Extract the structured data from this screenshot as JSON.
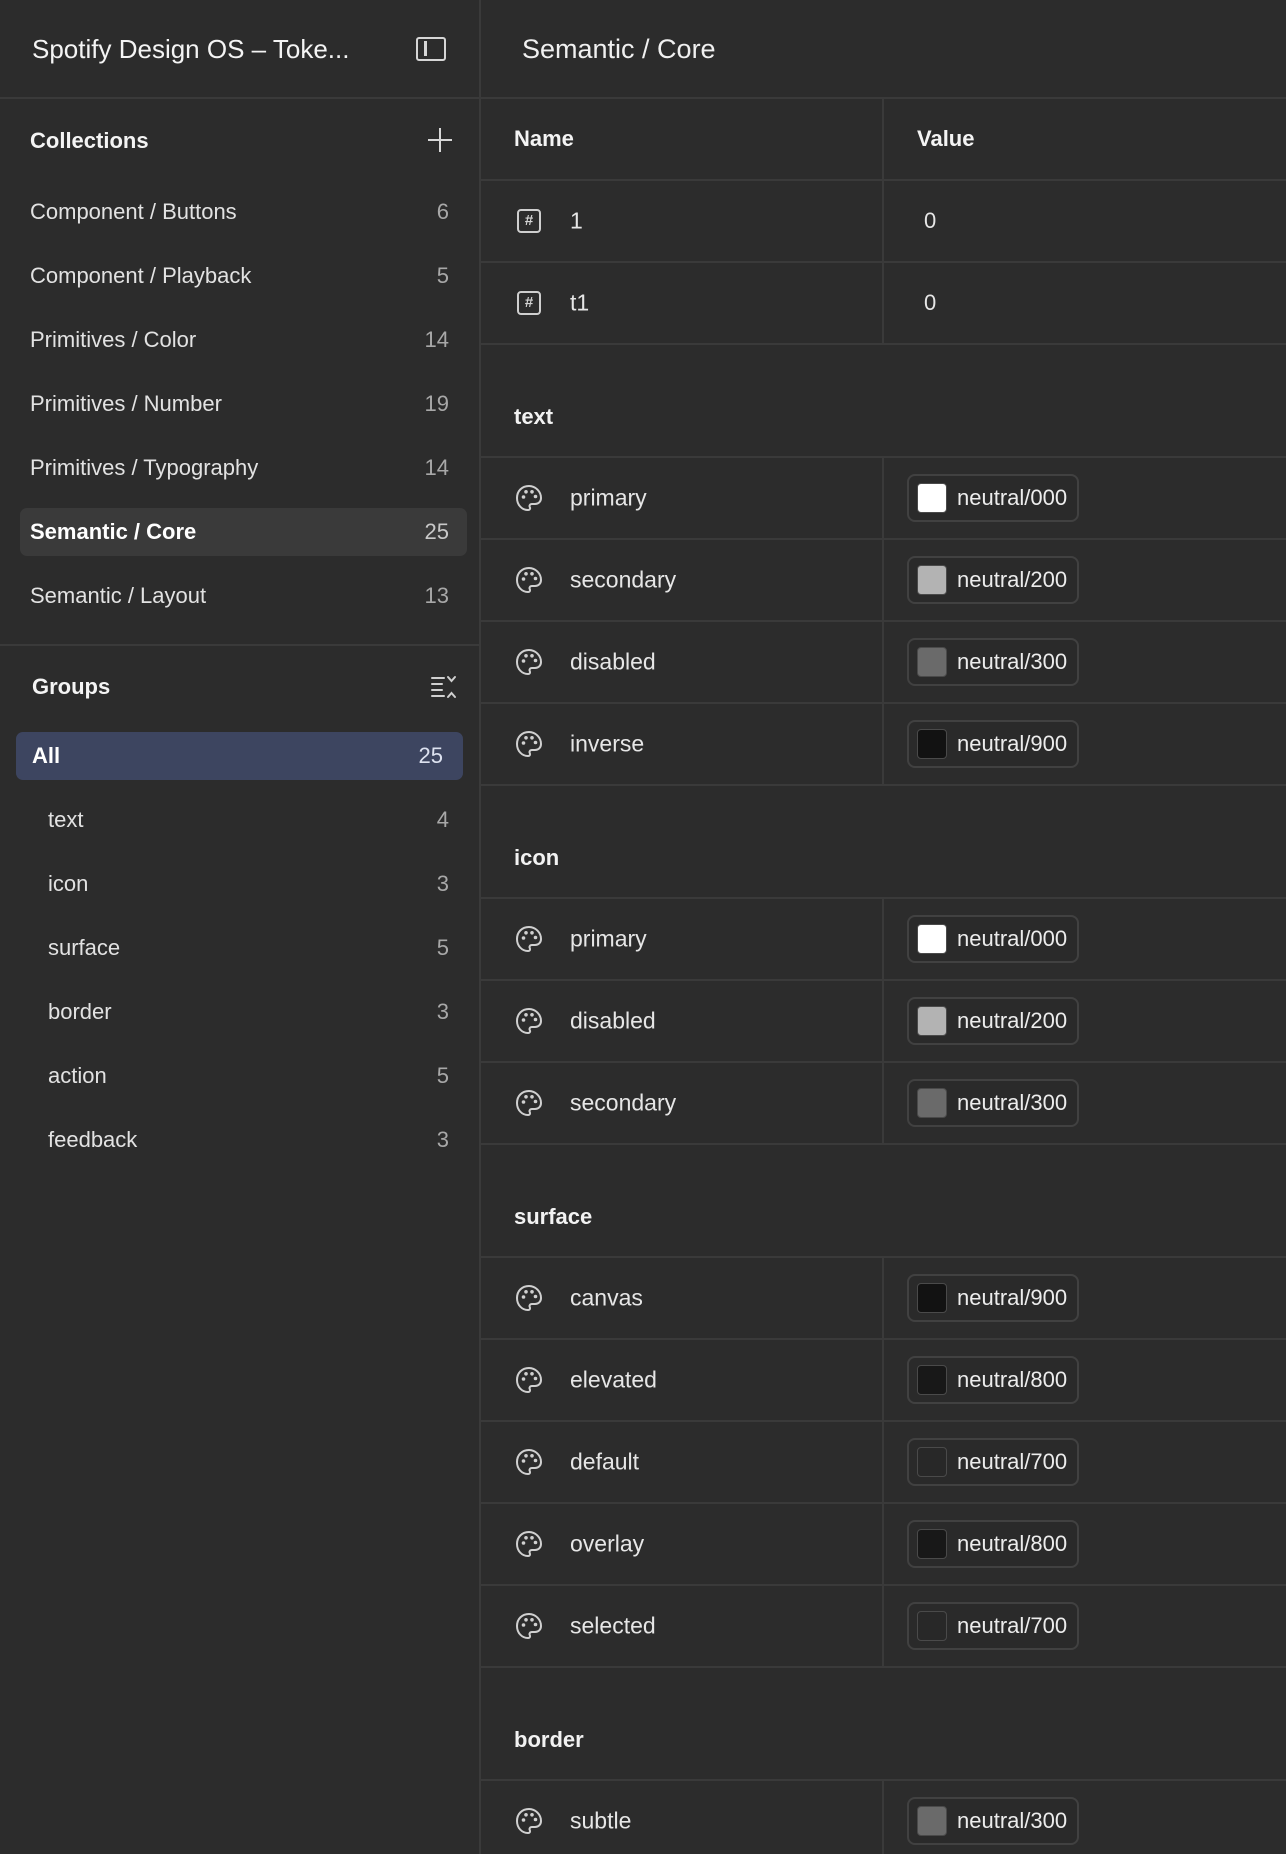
{
  "sidebar": {
    "file_title": "Spotify Design OS – Toke...",
    "collections_title": "Collections",
    "collections": [
      {
        "label": "Component / Buttons",
        "count": "6"
      },
      {
        "label": "Component / Playback",
        "count": "5"
      },
      {
        "label": "Primitives / Color",
        "count": "14"
      },
      {
        "label": "Primitives / Number",
        "count": "19"
      },
      {
        "label": "Primitives / Typography",
        "count": "14"
      },
      {
        "label": "Semantic / Core",
        "count": "25",
        "active": true
      },
      {
        "label": "Semantic / Layout",
        "count": "13"
      }
    ],
    "groups_title": "Groups",
    "groups": [
      {
        "label": "All",
        "count": "25",
        "active": true
      },
      {
        "label": "text",
        "count": "4"
      },
      {
        "label": "icon",
        "count": "3"
      },
      {
        "label": "surface",
        "count": "5"
      },
      {
        "label": "border",
        "count": "3"
      },
      {
        "label": "action",
        "count": "5"
      },
      {
        "label": "feedback",
        "count": "3"
      }
    ]
  },
  "main": {
    "title": "Semantic / Core",
    "col_name": "Name",
    "col_value": "Value",
    "number_rows": [
      {
        "name": "1",
        "value": "0"
      },
      {
        "name": "t1",
        "value": "0"
      }
    ],
    "groups": [
      {
        "name": "text",
        "rows": [
          {
            "name": "primary",
            "value": "neutral/000",
            "color": "#ffffff"
          },
          {
            "name": "secondary",
            "value": "neutral/200",
            "color": "#b3b3b3"
          },
          {
            "name": "disabled",
            "value": "neutral/300",
            "color": "#6a6a6a"
          },
          {
            "name": "inverse",
            "value": "neutral/900",
            "color": "#121212"
          }
        ]
      },
      {
        "name": "icon",
        "rows": [
          {
            "name": "primary",
            "value": "neutral/000",
            "color": "#ffffff"
          },
          {
            "name": "disabled",
            "value": "neutral/200",
            "color": "#b3b3b3"
          },
          {
            "name": "secondary",
            "value": "neutral/300",
            "color": "#6a6a6a"
          }
        ]
      },
      {
        "name": "surface",
        "rows": [
          {
            "name": "canvas",
            "value": "neutral/900",
            "color": "#121212"
          },
          {
            "name": "elevated",
            "value": "neutral/800",
            "color": "#181818"
          },
          {
            "name": "default",
            "value": "neutral/700",
            "color": "#282828"
          },
          {
            "name": "overlay",
            "value": "neutral/800",
            "color": "#181818"
          },
          {
            "name": "selected",
            "value": "neutral/700",
            "color": "#282828"
          }
        ]
      },
      {
        "name": "border",
        "rows": [
          {
            "name": "subtle",
            "value": "neutral/300",
            "color": "#6a6a6a"
          }
        ]
      }
    ]
  }
}
